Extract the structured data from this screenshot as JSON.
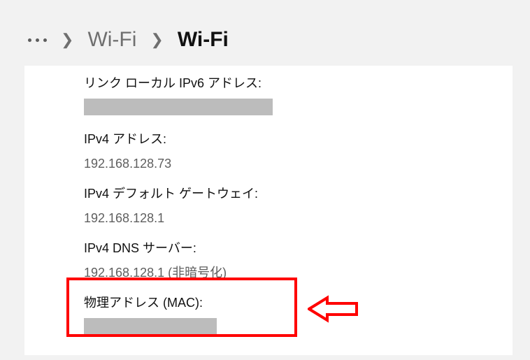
{
  "breadcrumb": {
    "first": "Wi-Fi",
    "current": "Wi-Fi"
  },
  "props": {
    "ipv6_link_local_label": "リンク ローカル IPv6 アドレス:",
    "ipv4_addr_label": "IPv4 アドレス:",
    "ipv4_addr_value": "192.168.128.73",
    "ipv4_gw_label": "IPv4 デフォルト ゲートウェイ:",
    "ipv4_gw_value": "192.168.128.1",
    "ipv4_dns_label": "IPv4 DNS サーバー:",
    "ipv4_dns_value": "192.168.128.1 (非暗号化)",
    "mac_label": "物理アドレス (MAC):"
  }
}
